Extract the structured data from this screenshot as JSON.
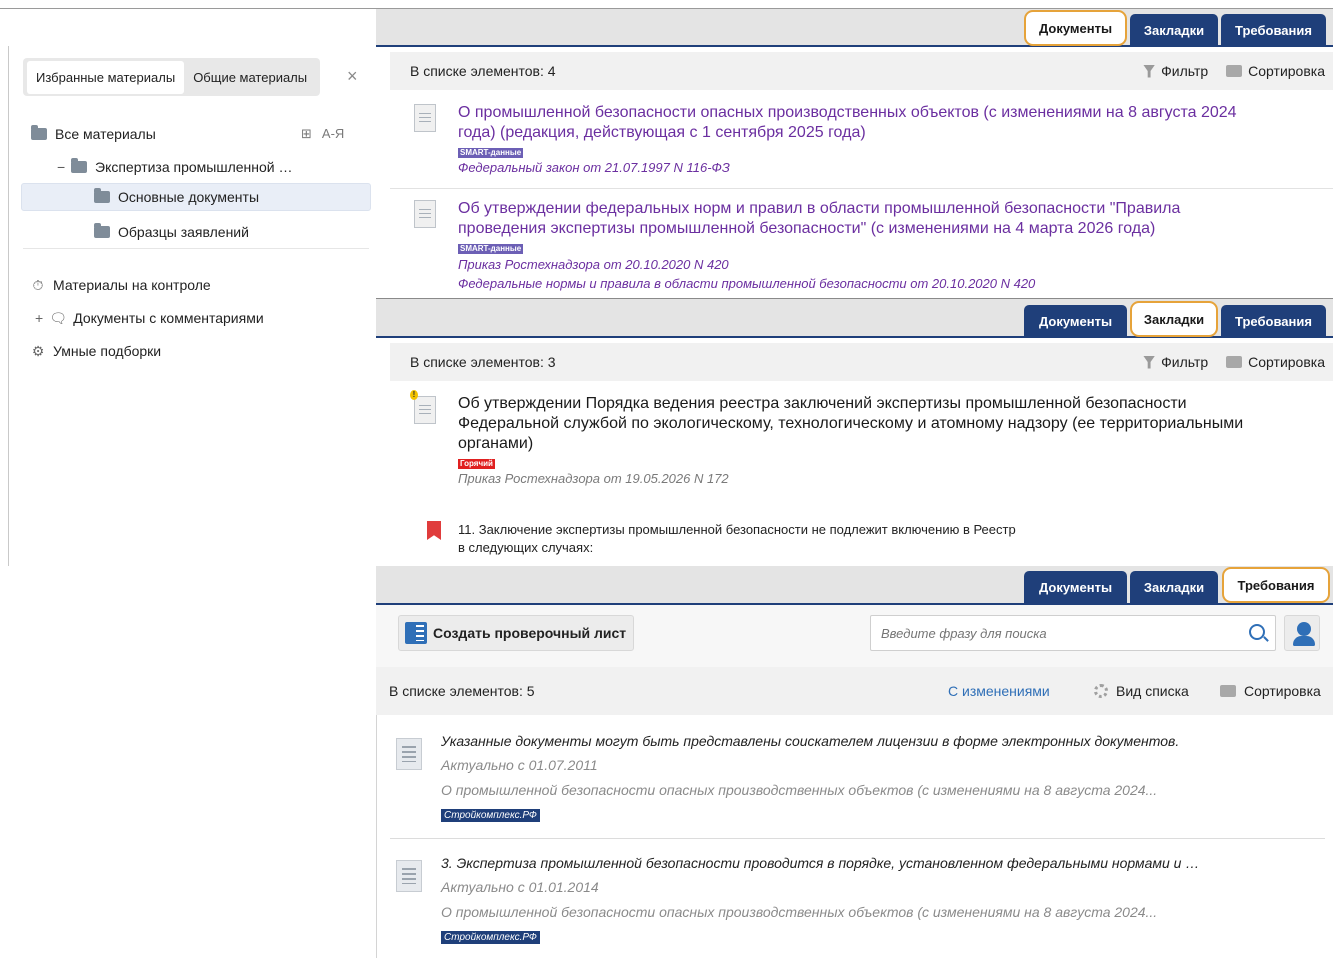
{
  "tabs": [
    "Документы",
    "Закладки",
    "Требования"
  ],
  "sidebar": {
    "tab_favorites": "Избранные материалы",
    "tab_shared": "Общие материалы",
    "close": "×",
    "tree": {
      "all": "Все материалы",
      "add_folder": "⊞",
      "sort_az": "А-Я",
      "expand_minus": "−",
      "expertise": "Экспертиза промышленной …",
      "main_docs": "Основные документы",
      "samples": "Образцы заявлений"
    },
    "control": "Материалы на контроле",
    "comments_plus": "+",
    "comments": "Документы с комментариями",
    "smart": "Умные подборки"
  },
  "documents_panel": {
    "count": "В списке элементов: 4",
    "filter": "Фильтр",
    "sort": "Сортировка",
    "items": [
      {
        "title_line1": "О промышленной безопасности опасных производственных объектов (с изменениями на 8 августа 2024",
        "title_line2": "года) (редакция, действующая с 1 сентября 2025 года)",
        "badge": "SMART-данные",
        "sub1": "Федеральный закон от 21.07.1997 N 116-ФЗ"
      },
      {
        "title_line1": "Об утверждении федеральных норм и правил в области промышленной безопасности \"Правила",
        "title_line2": "проведения экспертизы промышленной безопасности\" (с изменениями на 4 марта 2026 года)",
        "badge": "SMART-данные",
        "sub1": "Приказ Ростехнадзора от 20.10.2020 N 420",
        "sub2": "Федеральные нормы и правила в области промышленной безопасности от 20.10.2020 N 420"
      }
    ]
  },
  "bookmarks_panel": {
    "count": "В списке элементов: 3",
    "filter": "Фильтр",
    "sort": "Сортировка",
    "item": {
      "title_line1": "Об утверждении Порядка ведения реестра заключений экспертизы промышленной безопасности",
      "title_line2": "Федеральной службой по экологическому, технологическому и атомному надзору (ее территориальными",
      "title_line3": "органами)",
      "badge": "Горячий",
      "sub": "Приказ Ростехнадзора от 19.05.2026 N 172",
      "warning": "!",
      "bookmark_line1": "11. Заключение экспертизы промышленной безопасности не подлежит включению в Реестр",
      "bookmark_line2": "в следующих случаях:"
    }
  },
  "requirements_panel": {
    "create_button": "Создать проверочный лист",
    "search_placeholder": "Введите фразу для поиска",
    "count": "В списке элементов: 5",
    "with_changes": "С изменениями",
    "view_list": "Вид списка",
    "sort": "Сортировка",
    "items": [
      {
        "title": "Указанные документы могут быть представлены соискателем лицензии в форме электронных документов.",
        "date": "Актуально с 01.07.2011",
        "source": "О промышленной безопасности опасных производственных объектов (с изменениями на 8 августа 2024...",
        "tag": "Стройкомплекс.РФ"
      },
      {
        "title": "3. Экспертиза промышленной безопасности проводится в порядке, установленном федеральными нормами и …",
        "date": "Актуально с 01.01.2014",
        "source": "О промышленной безопасности опасных производственных объектов (с изменениями на 8 августа 2024...",
        "tag": "Стройкомплекс.РФ"
      }
    ]
  },
  "colors": {
    "tab_blue": "#1f3f7a",
    "highlight_orange": "#e6a33a",
    "link_purple": "#6b2fa0",
    "link_blue": "#2f6fb7"
  }
}
